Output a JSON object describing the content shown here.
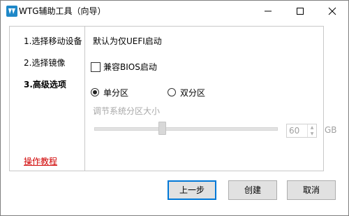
{
  "window": {
    "title": "WTG辅助工具（向导）",
    "accent_color": "#0078d7",
    "link_color": "#d00000",
    "app_icon": "app-logo-icon"
  },
  "title_buttons": {
    "minimize_icon": "minimize-icon",
    "maximize_icon": "maximize-icon",
    "close_icon": "close-icon"
  },
  "nav": {
    "steps": [
      {
        "label": "1.选择移动设备",
        "active": false
      },
      {
        "label": "2.选择镜像",
        "active": false
      },
      {
        "label": "3.高级选项",
        "active": true
      }
    ],
    "tutorial_link": "操作教程"
  },
  "options": {
    "default_boot_label": "默认为仅UEFI启动",
    "bios_compat": {
      "label": "兼容BIOS启动",
      "checked": false
    },
    "partition": {
      "single": {
        "label": "单分区",
        "selected": true
      },
      "dual": {
        "label": "双分区",
        "selected": false
      }
    },
    "system_size": {
      "label": "调节系统分区大小",
      "value": "60",
      "unit": "GB",
      "enabled": false,
      "slider_fraction": 0.37
    }
  },
  "buttons": {
    "prev": "上一步",
    "create": "创建",
    "cancel": "取消"
  }
}
